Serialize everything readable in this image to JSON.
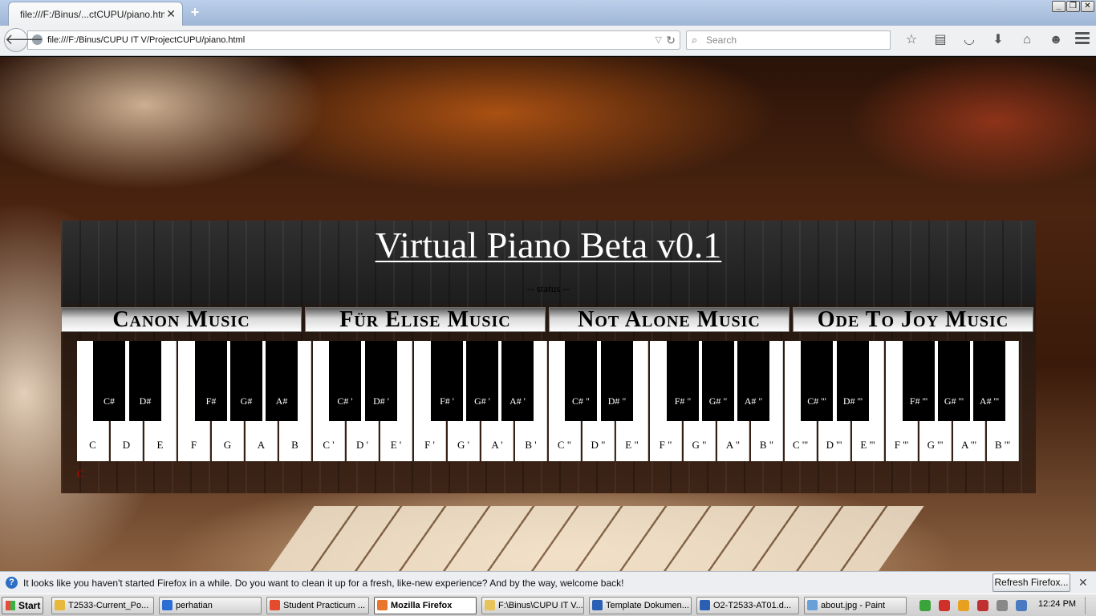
{
  "browser": {
    "tab_title": "file:///F:/Binus/...ctCUPU/piano.html",
    "tab_close": "✕",
    "new_tab": "+",
    "url": "file:///F:/Binus/CUPU IT V/ProjectCUPU/piano.html",
    "search_placeholder": "Search",
    "window_controls": [
      "_",
      "❐",
      "✕"
    ],
    "toolbar_icons": [
      "star-icon",
      "reading-list-icon",
      "pocket-icon",
      "download-icon",
      "home-icon",
      "hello-icon"
    ]
  },
  "page": {
    "title": "Virtual Piano Beta v0.1",
    "status": "-- status --",
    "songs": [
      "Canon Music",
      "Für Elise Music",
      "Not Alone Music",
      "Ode To Joy Music"
    ],
    "white_keys": [
      "C",
      "D",
      "E",
      "F",
      "G",
      "A",
      "B",
      "C '",
      "D '",
      "E '",
      "F '",
      "G '",
      "A '",
      "B '",
      "C \"",
      "D \"",
      "E \"",
      "F \"",
      "G \"",
      "A \"",
      "B \"",
      "C '''",
      "D '''",
      "E '''",
      "F '''",
      "G '''",
      "A '''",
      "B '''"
    ],
    "black_keys": [
      "C#",
      "D#",
      "F#",
      "G#",
      "A#",
      "C# '",
      "D# '",
      "F# '",
      "G# '",
      "A# '",
      "C# \"",
      "D# \"",
      "F# \"",
      "G# \"",
      "A# \"",
      "C# '''",
      "D# '''",
      "F# '''",
      "G# '''",
      "A# '''"
    ],
    "current_note": "C"
  },
  "notification": {
    "text": "It looks like you haven't started Firefox in a while. Do you want to clean it up for a fresh, like-new experience? And by the way, welcome back!",
    "button": "Refresh Firefox...",
    "close": "✕"
  },
  "taskbar": {
    "start": "Start",
    "items": [
      {
        "label": "T2533-Current_Po...",
        "color": "#e8b83c"
      },
      {
        "label": "perhatian",
        "color": "#2a6ed4"
      },
      {
        "label": "Student Practicum ...",
        "color": "#e44b2e"
      },
      {
        "label": "Mozilla Firefox",
        "color": "#e8762c",
        "active": true
      },
      {
        "label": "F:\\Binus\\CUPU IT V...",
        "color": "#e8c35a"
      },
      {
        "label": "Template Dokumen...",
        "color": "#2b5fb4"
      },
      {
        "label": "O2-T2533-AT01.d...",
        "color": "#2b5fb4"
      },
      {
        "label": "about.jpg - Paint",
        "color": "#6aa0d8"
      }
    ],
    "clock": "12:24 PM",
    "tray_colors": [
      "#3aa33a",
      "#d0302a",
      "#e8a020",
      "#c03030",
      "#888888",
      "#4a7ac0"
    ]
  }
}
